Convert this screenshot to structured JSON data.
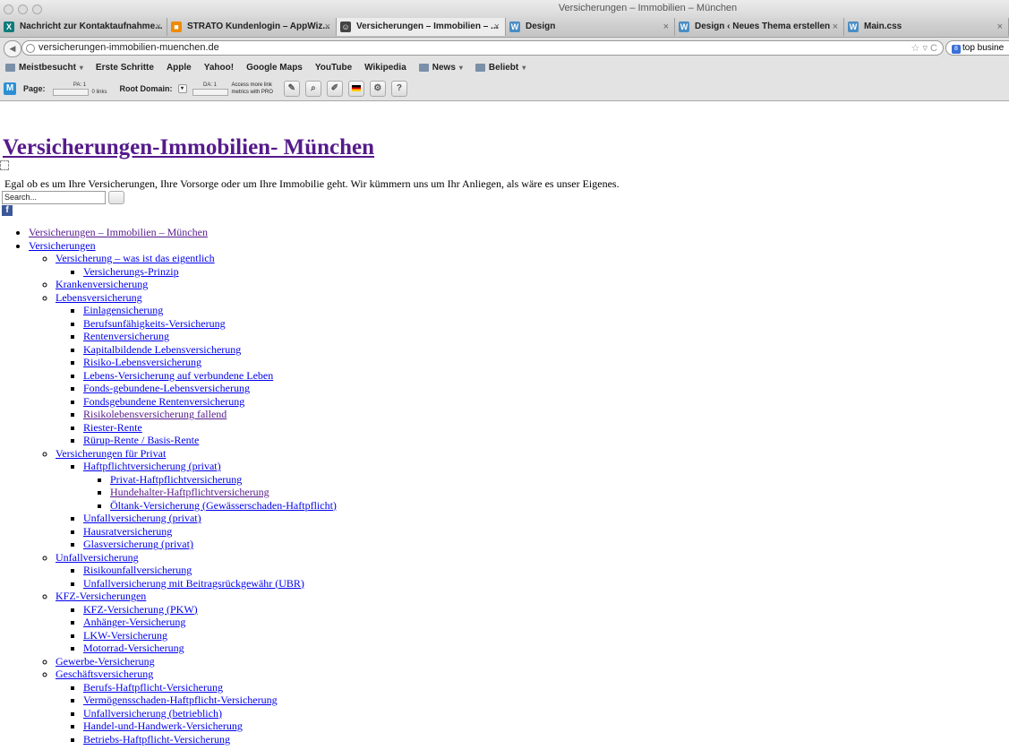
{
  "window": {
    "title": "Versicherungen – Immobilien – München"
  },
  "tabs": [
    {
      "label": "Nachricht zur Kontaktaufnahme...",
      "icon": "xing-icon",
      "active": false,
      "width": 187
    },
    {
      "label": "STRATO Kundenlogin – AppWiz...",
      "icon": "strato-icon",
      "active": false,
      "width": 189
    },
    {
      "label": "Versicherungen – Immobilien – ...",
      "icon": "site-icon",
      "active": true,
      "width": 189
    },
    {
      "label": "Design",
      "icon": "wordpress-icon",
      "active": false,
      "width": 189
    },
    {
      "label": "Design ‹ Neues Thema erstellen",
      "icon": "wordpress-icon",
      "active": false,
      "width": 189
    },
    {
      "label": "Main.css",
      "icon": "wordpress-icon",
      "active": false,
      "width": 184
    }
  ],
  "toolbar": {
    "url": "versicherungen-immobilien-muenchen.de",
    "url_controls": "☆ ▿ C",
    "search_text": "top busine"
  },
  "bookmarks": [
    {
      "label": "Meistbesucht",
      "type": "folder",
      "dropdown": true
    },
    {
      "label": "Erste Schritte",
      "type": "page",
      "dropdown": false
    },
    {
      "label": "Apple",
      "type": "page",
      "dropdown": false
    },
    {
      "label": "Yahoo!",
      "type": "page",
      "dropdown": false
    },
    {
      "label": "Google Maps",
      "type": "page",
      "dropdown": false
    },
    {
      "label": "YouTube",
      "type": "page",
      "dropdown": false
    },
    {
      "label": "Wikipedia",
      "type": "page",
      "dropdown": false
    },
    {
      "label": "News",
      "type": "folder",
      "dropdown": true
    },
    {
      "label": "Beliebt",
      "type": "folder",
      "dropdown": true
    }
  ],
  "mozbar": {
    "page_label": "Page:",
    "pa": "PA: 1",
    "links": "0 links",
    "root_label": "Root Domain:",
    "da": "DA: 1",
    "access_line1": "Access more link",
    "access_line2": "metrics with PRO",
    "tools": [
      "wrench-icon",
      "magnifier-icon",
      "pencil-icon",
      "flag-icon",
      "gear-icon",
      "help-icon"
    ]
  },
  "page": {
    "site_title": "Versicherungen-Immobilien- München",
    "description": "Egal ob es um Ihre Versicherungen, Ihre Vorsorge oder um Ihre Immobilie geht. Wir kümmern uns um Ihr Anliegen, als wäre es unser Eigenes.",
    "search_value": "Search...",
    "facebook_icon": "facebook-icon"
  },
  "menu": [
    {
      "label": "Versicherungen – Immobilien – München",
      "visited": true
    },
    {
      "label": "Versicherungen",
      "children": [
        {
          "label": "Versicherung – was ist das eigentlich",
          "children": [
            {
              "label": "Versicherungs-Prinzip"
            }
          ]
        },
        {
          "label": "Krankenversicherung"
        },
        {
          "label": "Lebensversicherung",
          "children": [
            {
              "label": "Einlagensicherung"
            },
            {
              "label": "Berufsunfähigkeits-Versicherung"
            },
            {
              "label": "Rentenversicherung"
            },
            {
              "label": "Kapitalbildende Lebensversicherung"
            },
            {
              "label": "Risiko-Lebensversicherung"
            },
            {
              "label": "Lebens-Versicherung auf verbundene Leben"
            },
            {
              "label": "Fonds-gebundene-Lebensversicherung"
            },
            {
              "label": "Fondsgebundene Rentenversicherung"
            },
            {
              "label": "Risikolebensversicherung fallend",
              "visited": true
            },
            {
              "label": "Riester-Rente"
            },
            {
              "label": "Rürup-Rente / Basis-Rente"
            }
          ]
        },
        {
          "label": "Versicherungen für Privat",
          "children": [
            {
              "label": "Haftpflichtversicherung (privat)",
              "children": [
                {
                  "label": "Privat-Haftpflichtversicherung"
                },
                {
                  "label": "Hundehalter-Haftpflichtversicherung",
                  "visited": true
                },
                {
                  "label": "Öltank-Versicherung (Gewässerschaden-Haftpflicht)"
                }
              ]
            },
            {
              "label": "Unfallversicherung (privat)"
            },
            {
              "label": "Hausratversicherung"
            },
            {
              "label": "Glasversicherung (privat)"
            }
          ]
        },
        {
          "label": "Unfallversicherung",
          "children": [
            {
              "label": "Risikounfallversicherung"
            },
            {
              "label": "Unfallversicherung mit Beitragsrückgewähr (UBR)"
            }
          ]
        },
        {
          "label": "KFZ-Versicherungen",
          "children": [
            {
              "label": "KFZ-Versicherung (PKW)"
            },
            {
              "label": "Anhänger-Versicherung"
            },
            {
              "label": "LKW-Versicherung"
            },
            {
              "label": "Motorrad-Versicherung"
            }
          ]
        },
        {
          "label": "Gewerbe-Versicherung"
        },
        {
          "label": "Geschäftsversicherung",
          "children": [
            {
              "label": "Berufs-Haftpflicht-Versicherung"
            },
            {
              "label": "Vermögensschaden-Haftpflicht-Versicherung"
            },
            {
              "label": "Unfallversicherung (betrieblich)"
            },
            {
              "label": "Handel-und-Handwerk-Versicherung"
            },
            {
              "label": "Betriebs-Haftpflicht-Versicherung"
            }
          ]
        }
      ]
    }
  ]
}
